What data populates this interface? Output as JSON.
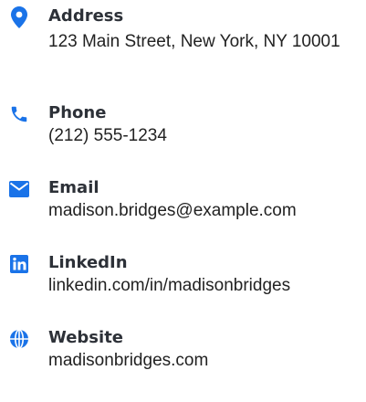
{
  "colors": {
    "accent": "#1a73e8",
    "label_text": "#2d3138",
    "value_text": "#222222"
  },
  "contacts": [
    {
      "icon": "map-pin-icon",
      "label": "Address",
      "value": "123 Main Street, New York, NY 10001"
    },
    {
      "icon": "phone-icon",
      "label": "Phone",
      "value": "(212) 555-1234"
    },
    {
      "icon": "envelope-icon",
      "label": "Email",
      "value": "madison.bridges@example.com"
    },
    {
      "icon": "linkedin-icon",
      "label": "LinkedIn",
      "value": "linkedin.com/in/madisonbridges"
    },
    {
      "icon": "globe-icon",
      "label": "Website",
      "value": "madisonbridges.com"
    }
  ]
}
